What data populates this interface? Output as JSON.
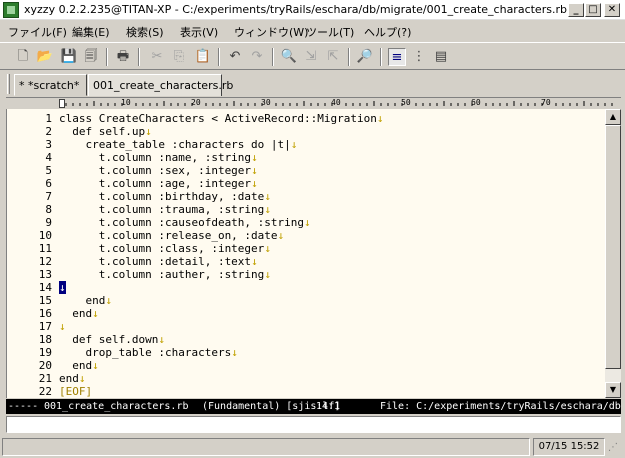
{
  "window": {
    "title": "xyzzy 0.2.2.235@TITAN-XP - C:/experiments/tryRails/eschara/db/migrate/001_create_characters.rb",
    "controls": {
      "minimize": "_",
      "maximize": "□",
      "close": "✕"
    }
  },
  "menu": [
    {
      "label": "ファイル(F)"
    },
    {
      "label": "編集(E)"
    },
    {
      "label": "検索(S)"
    },
    {
      "label": "表示(V)"
    },
    {
      "label": "ウィンドウ(W)"
    },
    {
      "label": "ツール(T)"
    },
    {
      "label": "ヘルプ(?)"
    }
  ],
  "toolbar": {
    "icons": [
      {
        "name": "new-file-icon",
        "glyph": "🗋"
      },
      {
        "name": "open-folder-icon",
        "glyph": "📂"
      },
      {
        "name": "save-icon",
        "glyph": "💾"
      },
      {
        "name": "save-all-icon",
        "glyph": "🗐"
      },
      {
        "name": "print-icon",
        "glyph": "🖶"
      },
      {
        "name": "cut-icon",
        "glyph": "✂"
      },
      {
        "name": "copy-icon",
        "glyph": "⎘"
      },
      {
        "name": "paste-icon",
        "glyph": "📋"
      },
      {
        "name": "undo-icon",
        "glyph": "↶"
      },
      {
        "name": "redo-icon",
        "glyph": "↷"
      },
      {
        "name": "find-icon",
        "glyph": "🔍"
      },
      {
        "name": "find-next-icon",
        "glyph": "⇲"
      },
      {
        "name": "find-prev-icon",
        "glyph": "⇱"
      },
      {
        "name": "grep-icon",
        "glyph": "🔎"
      },
      {
        "name": "fold-none-icon",
        "glyph": "≡"
      },
      {
        "name": "fold-column-icon",
        "glyph": "⋮"
      },
      {
        "name": "fold-window-icon",
        "glyph": "▤"
      }
    ]
  },
  "tabs": [
    {
      "label": "* *scratch*"
    },
    {
      "label": "001_create_characters.rb"
    }
  ],
  "ruler": {
    "labels": [
      "10",
      "20",
      "30",
      "40",
      "50",
      "60",
      "70"
    ]
  },
  "editor": {
    "lines": [
      {
        "n": "1",
        "code": "class CreateCharacters < ActiveRecord::Migration",
        "nl": "↓"
      },
      {
        "n": "2",
        "code": "  def self.up",
        "nl": "↓"
      },
      {
        "n": "3",
        "code": "    create_table :characters do |t|",
        "nl": "↓"
      },
      {
        "n": "4",
        "code": "      t.column :name, :string",
        "nl": "↓"
      },
      {
        "n": "5",
        "code": "      t.column :sex, :integer",
        "nl": "↓"
      },
      {
        "n": "6",
        "code": "      t.column :age, :integer",
        "nl": "↓"
      },
      {
        "n": "7",
        "code": "      t.column :birthday, :date",
        "nl": "↓"
      },
      {
        "n": "8",
        "code": "      t.column :trauma, :string",
        "nl": "↓"
      },
      {
        "n": "9",
        "code": "      t.column :causeofdeath, :string",
        "nl": "↓"
      },
      {
        "n": "10",
        "code": "      t.column :release_on, :date",
        "nl": "↓"
      },
      {
        "n": "11",
        "code": "      t.column :class, :integer",
        "nl": "↓"
      },
      {
        "n": "12",
        "code": "      t.column :detail, :text",
        "nl": "↓"
      },
      {
        "n": "13",
        "code": "      t.column :auther, :string",
        "nl": "↓"
      },
      {
        "n": "14",
        "code": "",
        "nl": "↓",
        "cursor": true
      },
      {
        "n": "15",
        "code": "    end",
        "nl": "↓"
      },
      {
        "n": "16",
        "code": "  end",
        "nl": "↓"
      },
      {
        "n": "17",
        "code": "",
        "nl": "↓"
      },
      {
        "n": "18",
        "code": "  def self.down",
        "nl": "↓"
      },
      {
        "n": "19",
        "code": "    drop_table :characters",
        "nl": "↓"
      },
      {
        "n": "20",
        "code": "  end",
        "nl": "↓"
      },
      {
        "n": "21",
        "code": "end",
        "nl": "↓"
      },
      {
        "n": "22",
        "code": "[EOF]",
        "nl": "",
        "eof": true
      }
    ]
  },
  "modeline": {
    "prefix": "-----",
    "buffer": "001_create_characters.rb",
    "mode": "(Fundamental) [sjis:lf]",
    "position": "14:1",
    "file": "File: C:/experiments/tryRails/eschara/db/migra"
  },
  "status": {
    "clock": "07/15 15:52"
  },
  "colors": {
    "editor_bg": "#fffbf0",
    "modeline_bg": "#000000",
    "cursor": "#000080",
    "newline_mark": "#c0a000"
  }
}
